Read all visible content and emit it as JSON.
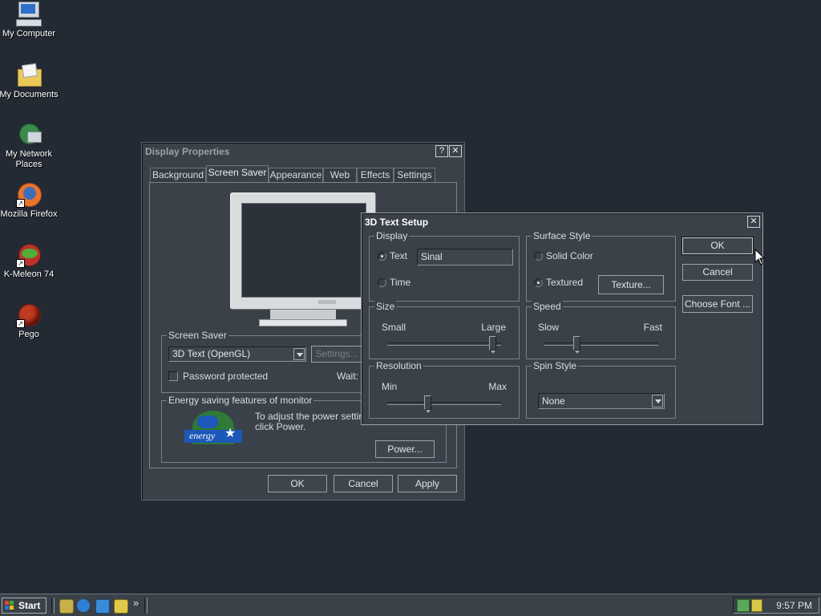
{
  "desktop": {
    "icons": [
      {
        "label": "My Computer"
      },
      {
        "label": "My Documents"
      },
      {
        "label": "My Network Places"
      },
      {
        "label": "Mozilla Firefox"
      },
      {
        "label": "K-Meleon 74"
      },
      {
        "label": "Pego"
      }
    ]
  },
  "display_properties": {
    "title": "Display Properties",
    "help_label": "?",
    "close_label": "✕",
    "tabs": [
      "Background",
      "Screen Saver",
      "Appearance",
      "Web",
      "Effects",
      "Settings"
    ],
    "active_tab": "Screen Saver",
    "screen_saver_group": "Screen Saver",
    "screen_saver_value": "3D Text (OpenGL)",
    "settings_button": "Settings...",
    "password_protected": "Password protected",
    "wait_label": "Wait:",
    "energy_group": "Energy saving features of monitor",
    "energy_text_1": "To adjust the power settings",
    "energy_text_2": "click Power.",
    "energy_logo_text": "energy",
    "power_button": "Power...",
    "ok_button": "OK",
    "cancel_button": "Cancel",
    "apply_button": "Apply"
  },
  "text_setup": {
    "title": "3D Text Setup",
    "close_label": "✕",
    "display_group": "Display",
    "radio_text": "Text",
    "text_value": "Sinal",
    "radio_time": "Time",
    "surface_group": "Surface Style",
    "radio_solid": "Solid Color",
    "radio_textured": "Textured",
    "texture_button": "Texture...",
    "size_group": "Size",
    "size_min": "Small",
    "size_max": "Large",
    "size_level": 0.92,
    "speed_group": "Speed",
    "speed_min": "Slow",
    "speed_max": "Fast",
    "speed_level": 0.28,
    "resolution_group": "Resolution",
    "resolution_min": "Min",
    "resolution_max": "Max",
    "resolution_level": 0.35,
    "spin_group": "Spin Style",
    "spin_value": "None",
    "ok_button": "OK",
    "cancel_button": "Cancel",
    "choose_font_button": "Choose Font ..."
  },
  "taskbar": {
    "start_label": "Start",
    "quick_launch_more": "»",
    "clock": "9:57 PM"
  }
}
